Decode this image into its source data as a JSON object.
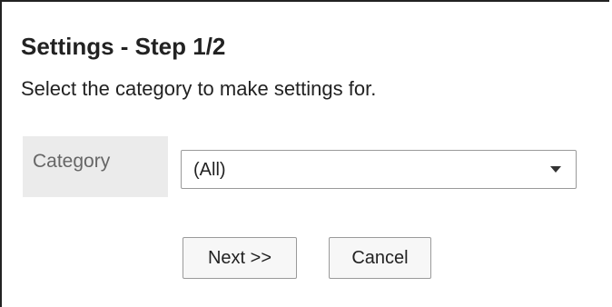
{
  "page": {
    "title": "Settings - Step 1/2",
    "description": "Select the category to make settings for."
  },
  "form": {
    "category_label": "Category",
    "category_value": "(All)",
    "category_icon": "dropdown-arrow-icon"
  },
  "buttons": {
    "next_label": "Next >>",
    "cancel_label": "Cancel"
  },
  "colors": {
    "label_background": "#ebebeb",
    "label_text": "#666666",
    "border": "#9a9a9a",
    "button_background": "#f7f7f7"
  }
}
